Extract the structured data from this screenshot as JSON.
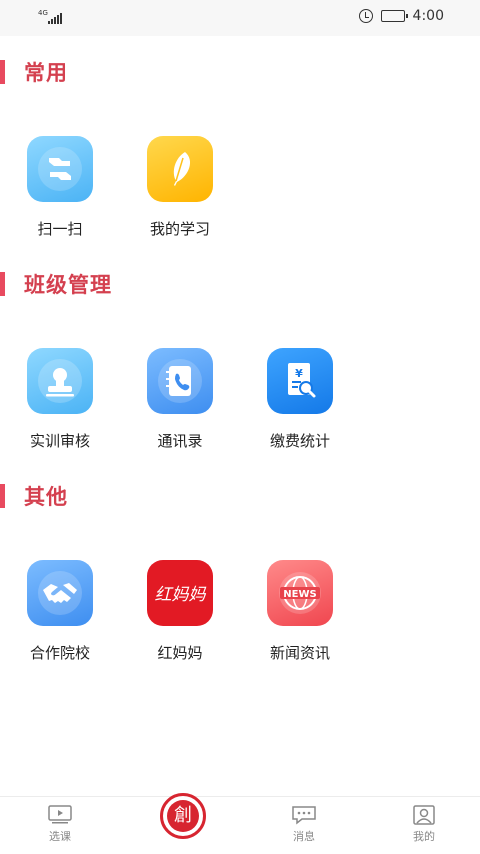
{
  "status_bar": {
    "network": "4G",
    "time": "4:00"
  },
  "sections": [
    {
      "title": "常用",
      "items": [
        {
          "label": "扫一扫",
          "icon": "scan-icon"
        },
        {
          "label": "我的学习",
          "icon": "feather-icon"
        }
      ]
    },
    {
      "title": "班级管理",
      "items": [
        {
          "label": "实训审核",
          "icon": "stamp-icon"
        },
        {
          "label": "通讯录",
          "icon": "contacts-book-icon"
        },
        {
          "label": "缴费统计",
          "icon": "payment-search-icon"
        }
      ]
    },
    {
      "title": "其他",
      "items": [
        {
          "label": "合作院校",
          "icon": "handshake-icon"
        },
        {
          "label": "红妈妈",
          "icon": "hongmama-brand-icon",
          "brand_text": "红妈妈"
        },
        {
          "label": "新闻资讯",
          "icon": "news-globe-icon",
          "icon_text": "NEWS"
        }
      ]
    }
  ],
  "bottom_nav": {
    "items": [
      {
        "label": "选课",
        "icon": "video-course-icon"
      },
      {
        "label": "",
        "icon": "school-logo-icon"
      },
      {
        "label": "消息",
        "icon": "message-icon"
      },
      {
        "label": "我的",
        "icon": "profile-icon"
      }
    ]
  },
  "colors": {
    "accent": "#d4404f",
    "section_bar": "#e84a5f",
    "brand_red": "#e21a24"
  }
}
